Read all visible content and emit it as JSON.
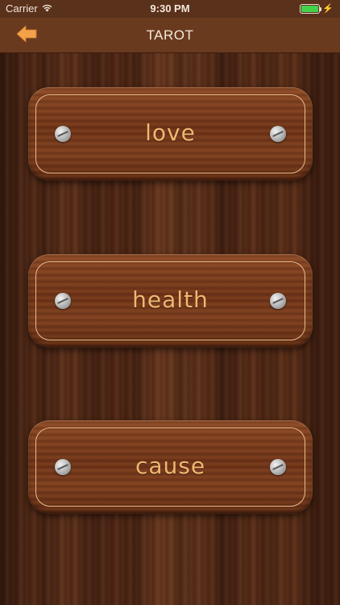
{
  "status_bar": {
    "carrier": "Carrier",
    "time": "9:30 PM",
    "wifi_icon": "wifi-icon",
    "battery_icon": "battery-icon",
    "charging_icon": "bolt-icon"
  },
  "nav": {
    "title": "TAROT",
    "back_icon": "back-arrow-icon"
  },
  "menu": {
    "items": [
      {
        "label": "love"
      },
      {
        "label": "health"
      },
      {
        "label": "cause"
      }
    ]
  },
  "colors": {
    "nav_bg": "#6a3a1f",
    "label": "#f0b770",
    "back_arrow": "#f3a24a",
    "battery": "#43d24a"
  }
}
